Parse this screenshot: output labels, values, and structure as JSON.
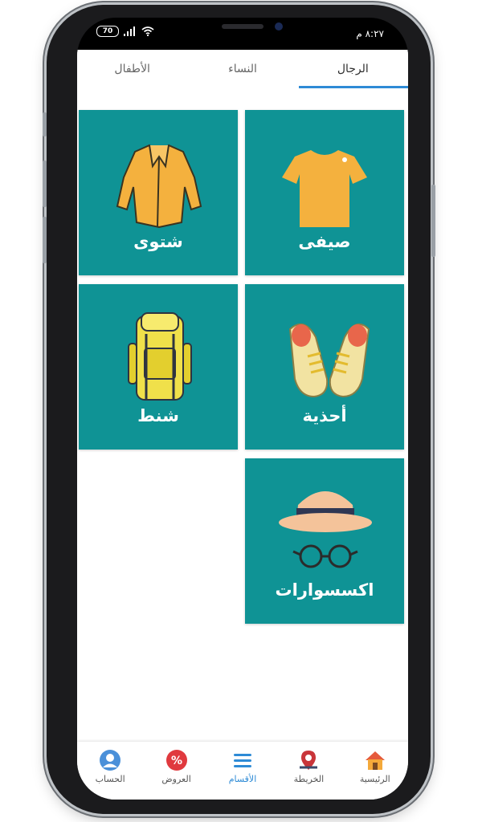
{
  "status": {
    "time": "٨:٢٧ م",
    "battery": "70"
  },
  "tabs": [
    {
      "label": "الرجال",
      "active": true
    },
    {
      "label": "النساء",
      "active": false
    },
    {
      "label": "الأطفال",
      "active": false
    }
  ],
  "categories": [
    {
      "label": "صيفى",
      "icon": "tshirt-icon"
    },
    {
      "label": "شتوى",
      "icon": "jacket-icon"
    },
    {
      "label": "أحذية",
      "icon": "sneakers-icon"
    },
    {
      "label": "شنط",
      "icon": "backpack-icon"
    },
    {
      "label": "اكسسوارات",
      "icon": "hat-glasses-icon"
    }
  ],
  "nav": [
    {
      "label": "الرئيسية",
      "icon": "home-icon",
      "active": false
    },
    {
      "label": "الخريطة",
      "icon": "map-icon",
      "active": false
    },
    {
      "label": "الأقسام",
      "icon": "menu-icon",
      "active": true
    },
    {
      "label": "العروض",
      "icon": "offers-percent-icon",
      "active": false
    },
    {
      "label": "الحساب",
      "icon": "user-icon",
      "active": false
    }
  ],
  "colors": {
    "tile": "#0f9395",
    "accent": "#2e8bd6",
    "item": "#f4b13e"
  }
}
